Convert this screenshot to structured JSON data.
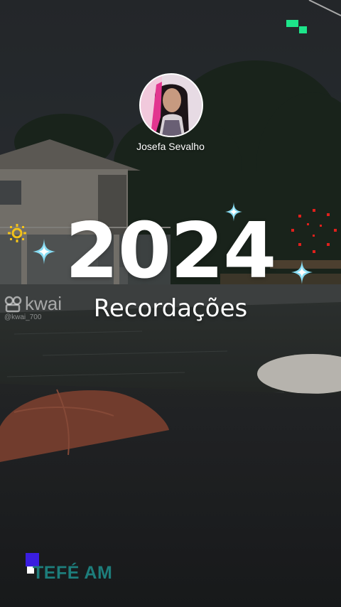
{
  "profile": {
    "author_name": "Josefa Sevalho",
    "avatar": "profile-photo"
  },
  "card": {
    "year": "2024",
    "subtitle": "Recordações"
  },
  "watermark": {
    "logo_text": "kwai",
    "handle": "@kwai_700"
  },
  "location": {
    "label": "TEFÉ AM"
  },
  "icons": {
    "sparkle": "sparkle-icon",
    "sun": "sun-icon",
    "fireworks": "fireworks-icon",
    "kwai": "kwai-logo-icon"
  },
  "colors": {
    "accent_green": "#1de58a",
    "location_teal": "#1d7d7b",
    "location_mark": "#3a1ee0",
    "sparkle": "#7fd6f0",
    "fireworks": "#e0201c",
    "sun": "#f2c21a"
  }
}
